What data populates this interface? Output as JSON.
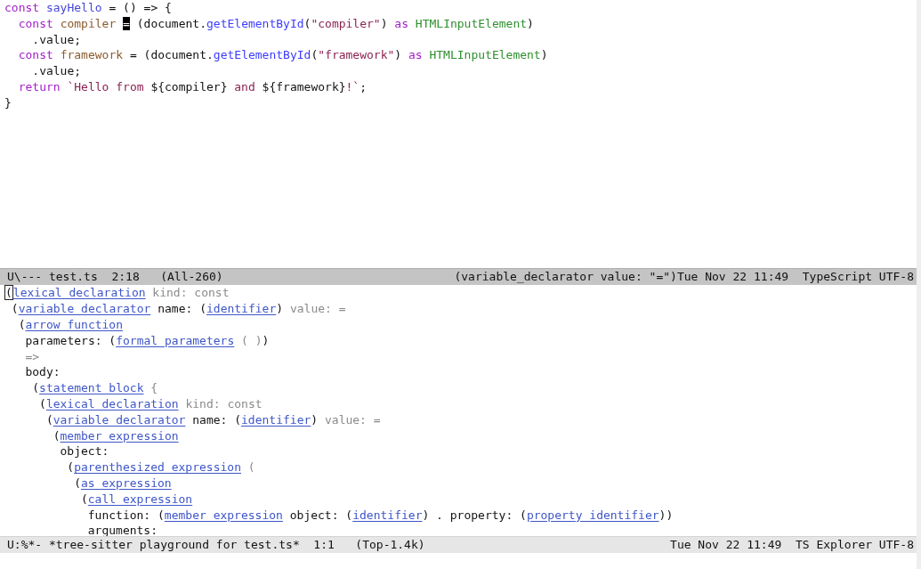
{
  "code_window": {
    "lines": [
      [
        {
          "kind": "keyword",
          "text": "const "
        },
        {
          "kind": "function",
          "text": "sayHello"
        },
        {
          "kind": "plain",
          "text": " = () => {"
        }
      ],
      [
        {
          "kind": "keyword",
          "text": "  const "
        },
        {
          "kind": "variable",
          "text": "compiler "
        },
        {
          "kind": "cursor",
          "text": "="
        },
        {
          "kind": "plain",
          "text": " (document."
        },
        {
          "kind": "method",
          "text": "getElementById"
        },
        {
          "kind": "plain",
          "text": "("
        },
        {
          "kind": "string",
          "text": "\"compiler\""
        },
        {
          "kind": "plain",
          "text": ") "
        },
        {
          "kind": "keyword",
          "text": "as "
        },
        {
          "kind": "type",
          "text": "HTMLInputElement"
        },
        {
          "kind": "plain",
          "text": ")"
        }
      ],
      [
        {
          "kind": "plain",
          "text": "    .value;"
        }
      ],
      [
        {
          "kind": "keyword",
          "text": "  const "
        },
        {
          "kind": "variable",
          "text": "framework"
        },
        {
          "kind": "plain",
          "text": " = (document."
        },
        {
          "kind": "method",
          "text": "getElementById"
        },
        {
          "kind": "plain",
          "text": "("
        },
        {
          "kind": "string",
          "text": "\"framework\""
        },
        {
          "kind": "plain",
          "text": ") "
        },
        {
          "kind": "keyword",
          "text": "as "
        },
        {
          "kind": "type",
          "text": "HTMLInputElement"
        },
        {
          "kind": "plain",
          "text": ")"
        }
      ],
      [
        {
          "kind": "plain",
          "text": "    .value;"
        }
      ],
      [
        {
          "kind": "keyword",
          "text": "  return "
        },
        {
          "kind": "string",
          "text": "`Hello from "
        },
        {
          "kind": "plain",
          "text": "${compiler}"
        },
        {
          "kind": "string",
          "text": " and "
        },
        {
          "kind": "plain",
          "text": "${framework}"
        },
        {
          "kind": "string",
          "text": "!`"
        },
        {
          "kind": "plain",
          "text": ";"
        }
      ],
      [
        {
          "kind": "plain",
          "text": "}"
        }
      ]
    ]
  },
  "code_mode_line": {
    "active": true,
    "left": "U\\--- test.ts  2:18   (All-260)",
    "right": "(variable_declarator value: \"=\")Tue Nov 22 11:49  TypeScript UTF-8"
  },
  "tree_window": {
    "nodes": [
      {
        "tokens": [
          {
            "kind": "cursor",
            "text": "("
          },
          {
            "kind": "node",
            "text": "lexical_declaration"
          },
          {
            "kind": "dim",
            "text": " kind: const"
          }
        ],
        "children": [
          {
            "tokens": [
              {
                "kind": "text",
                "text": "("
              },
              {
                "kind": "node",
                "text": "variable_declarator"
              },
              {
                "kind": "text",
                "text": " name: ("
              },
              {
                "kind": "node",
                "text": "identifier"
              },
              {
                "kind": "text",
                "text": ")"
              },
              {
                "kind": "dim",
                "text": " value: ="
              }
            ],
            "children": [
              {
                "tokens": [
                  {
                    "kind": "text",
                    "text": "("
                  },
                  {
                    "kind": "node",
                    "text": "arrow_function"
                  }
                ],
                "children": [
                  {
                    "tokens": [
                      {
                        "kind": "text",
                        "text": "parameters: ("
                      },
                      {
                        "kind": "node",
                        "text": "formal_parameters"
                      },
                      {
                        "kind": "dim",
                        "text": " ( )"
                      },
                      {
                        "kind": "text",
                        "text": ")"
                      }
                    ]
                  },
                  {
                    "tokens": [
                      {
                        "kind": "dim",
                        "text": "=>"
                      }
                    ]
                  },
                  {
                    "tokens": [
                      {
                        "kind": "text",
                        "text": "body:"
                      }
                    ],
                    "children": [
                      {
                        "tokens": [
                          {
                            "kind": "text",
                            "text": "("
                          },
                          {
                            "kind": "node",
                            "text": "statement_block"
                          },
                          {
                            "kind": "dim",
                            "text": " {"
                          }
                        ],
                        "children": [
                          {
                            "tokens": [
                              {
                                "kind": "text",
                                "text": "("
                              },
                              {
                                "kind": "node",
                                "text": "lexical_declaration"
                              },
                              {
                                "kind": "dim",
                                "text": " kind: const"
                              }
                            ],
                            "children": [
                              {
                                "tokens": [
                                  {
                                    "kind": "text",
                                    "text": "("
                                  },
                                  {
                                    "kind": "node",
                                    "text": "variable_declarator"
                                  },
                                  {
                                    "kind": "text",
                                    "text": " name: ("
                                  },
                                  {
                                    "kind": "node",
                                    "text": "identifier"
                                  },
                                  {
                                    "kind": "text",
                                    "text": ")"
                                  },
                                  {
                                    "kind": "dim",
                                    "text": " value: ="
                                  }
                                ],
                                "children": [
                                  {
                                    "tokens": [
                                      {
                                        "kind": "text",
                                        "text": "("
                                      },
                                      {
                                        "kind": "node",
                                        "text": "member_expression"
                                      }
                                    ],
                                    "children": [
                                      {
                                        "tokens": [
                                          {
                                            "kind": "text",
                                            "text": "object:"
                                          }
                                        ],
                                        "children": [
                                          {
                                            "tokens": [
                                              {
                                                "kind": "text",
                                                "text": "("
                                              },
                                              {
                                                "kind": "node",
                                                "text": "parenthesized_expression"
                                              },
                                              {
                                                "kind": "dim",
                                                "text": " ("
                                              }
                                            ],
                                            "children": [
                                              {
                                                "tokens": [
                                                  {
                                                    "kind": "text",
                                                    "text": "("
                                                  },
                                                  {
                                                    "kind": "node",
                                                    "text": "as_expression"
                                                  }
                                                ],
                                                "children": [
                                                  {
                                                    "tokens": [
                                                      {
                                                        "kind": "text",
                                                        "text": "("
                                                      },
                                                      {
                                                        "kind": "node",
                                                        "text": "call_expression"
                                                      }
                                                    ],
                                                    "children": [
                                                      {
                                                        "tokens": [
                                                          {
                                                            "kind": "text",
                                                            "text": "function: ("
                                                          },
                                                          {
                                                            "kind": "node",
                                                            "text": "member_expression"
                                                          },
                                                          {
                                                            "kind": "text",
                                                            "text": " object: ("
                                                          },
                                                          {
                                                            "kind": "node",
                                                            "text": "identifier"
                                                          },
                                                          {
                                                            "kind": "text",
                                                            "text": ") . property: ("
                                                          },
                                                          {
                                                            "kind": "node",
                                                            "text": "property_identifier"
                                                          },
                                                          {
                                                            "kind": "text",
                                                            "text": "))"
                                                          }
                                                        ]
                                                      },
                                                      {
                                                        "tokens": [
                                                          {
                                                            "kind": "text",
                                                            "text": "arguments:"
                                                          }
                                                        ]
                                                      }
                                                    ]
                                                  }
                                                ]
                                              }
                                            ]
                                          }
                                        ]
                                      }
                                    ]
                                  }
                                ]
                              }
                            ]
                          }
                        ]
                      }
                    ]
                  }
                ]
              }
            ]
          }
        ]
      }
    ]
  },
  "tree_mode_line": {
    "active": false,
    "left": "U:%*- *tree-sitter playground for test.ts*  1:1   (Top-1.4k)",
    "right": "Tue Nov 22 11:49  TS Explorer UTF-8"
  }
}
